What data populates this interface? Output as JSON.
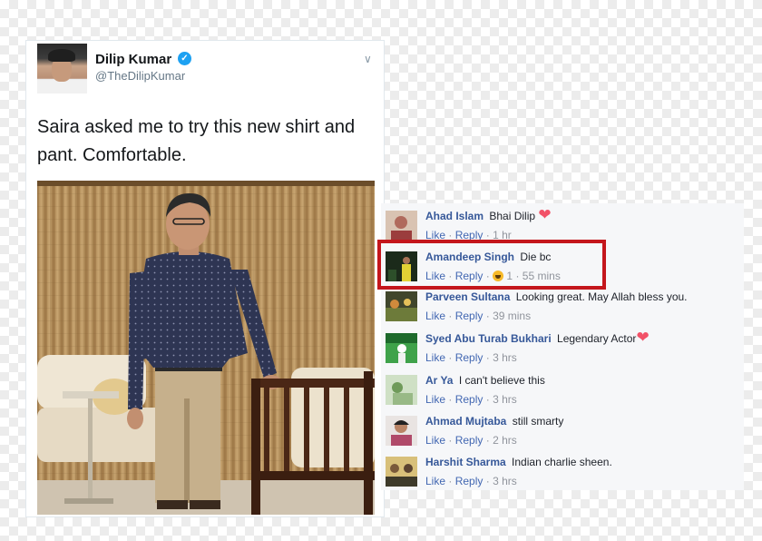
{
  "tweet": {
    "author_name": "Dilip Kumar",
    "author_handle": "@TheDilipKumar",
    "verified_icon": "✓",
    "menu_icon": "∨",
    "text": "Saira asked me to try this new shirt and pant. Comfortable."
  },
  "comments": [
    {
      "name": "Ahad Islam",
      "text": "Bhai Dilip",
      "emoji": "❤",
      "like": "Like",
      "sep1": "·",
      "reply": "Reply",
      "sep2": "·",
      "time": "1 hr",
      "reaction_count": ""
    },
    {
      "name": "Amandeep Singh",
      "text": "Die bc",
      "emoji": "",
      "like": "Like",
      "sep1": "·",
      "reply": "Reply",
      "sep2": "·",
      "time": "55 mins",
      "reaction_count": "1"
    },
    {
      "name": "Parveen Sultana",
      "text": "Looking great. May Allah bless you.",
      "emoji": "",
      "like": "Like",
      "sep1": "·",
      "reply": "Reply",
      "sep2": "·",
      "time": "39 mins",
      "reaction_count": ""
    },
    {
      "name": "Syed Abu Turab Bukhari",
      "text": "Legendary Actor",
      "emoji": "❤",
      "like": "Like",
      "sep1": "·",
      "reply": "Reply",
      "sep2": "·",
      "time": "3 hrs",
      "reaction_count": ""
    },
    {
      "name": "Ar Ya",
      "text": "I can't believe this",
      "emoji": "",
      "like": "Like",
      "sep1": "·",
      "reply": "Reply",
      "sep2": "·",
      "time": "3 hrs",
      "reaction_count": ""
    },
    {
      "name": "Ahmad Mujtaba",
      "text": "still smarty",
      "emoji": "",
      "like": "Like",
      "sep1": "·",
      "reply": "Reply",
      "sep2": "·",
      "time": "2 hrs",
      "reaction_count": ""
    },
    {
      "name": "Harshit Sharma",
      "text": "Indian charlie sheen.",
      "emoji": "",
      "like": "Like",
      "sep1": "·",
      "reply": "Reply",
      "sep2": "·",
      "time": "3 hrs",
      "reaction_count": ""
    }
  ],
  "colors": {
    "name_link": "#365899",
    "action_link": "#4267b2",
    "meta_grey": "#90949c",
    "highlight_red": "#c4161c",
    "verified_blue": "#1da1f2",
    "heart": "#f25268"
  }
}
